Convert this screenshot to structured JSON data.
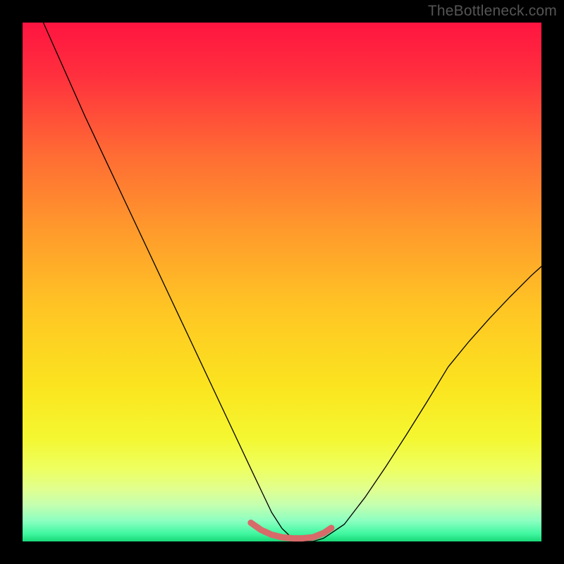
{
  "watermark": "TheBottleneck.com",
  "chart_data": {
    "type": "line",
    "title": "",
    "xlabel": "",
    "ylabel": "",
    "xlim": [
      0,
      100
    ],
    "ylim": [
      0,
      100
    ],
    "background_gradient": {
      "stops": [
        {
          "offset": 0.0,
          "color": "#ff1440"
        },
        {
          "offset": 0.1,
          "color": "#ff2f3e"
        },
        {
          "offset": 0.25,
          "color": "#ff6a34"
        },
        {
          "offset": 0.4,
          "color": "#ff9a2c"
        },
        {
          "offset": 0.55,
          "color": "#ffc524"
        },
        {
          "offset": 0.7,
          "color": "#fbe41f"
        },
        {
          "offset": 0.8,
          "color": "#f4f730"
        },
        {
          "offset": 0.86,
          "color": "#eeff60"
        },
        {
          "offset": 0.9,
          "color": "#e0ff90"
        },
        {
          "offset": 0.93,
          "color": "#c4ffb0"
        },
        {
          "offset": 0.96,
          "color": "#8cffc0"
        },
        {
          "offset": 0.985,
          "color": "#40f7a0"
        },
        {
          "offset": 1.0,
          "color": "#18d878"
        }
      ]
    },
    "series": [
      {
        "name": "bottleneck-curve",
        "color": "#000000",
        "stroke_width": 1.3,
        "x": [
          4,
          8,
          12,
          16,
          20,
          24,
          28,
          32,
          36,
          40,
          44,
          46,
          48,
          50,
          52,
          54,
          56,
          58,
          62,
          66,
          70,
          74,
          78,
          82,
          86,
          90,
          94,
          98,
          100
        ],
        "values": [
          100,
          91,
          82,
          73.5,
          65,
          56.5,
          48,
          39.5,
          31,
          22.5,
          14,
          9.8,
          5.6,
          2.5,
          0.6,
          0,
          0,
          0.6,
          3.3,
          8.5,
          14.4,
          20.6,
          27.0,
          33.6,
          38.5,
          43.0,
          47.2,
          51.2,
          53.0
        ]
      },
      {
        "name": "optimal-zone",
        "color": "#d86a6a",
        "stroke_width": 9,
        "linecap": "round",
        "x": [
          44,
          46,
          48,
          50,
          52,
          54,
          56,
          58,
          59.5
        ],
        "values": [
          3.6,
          2.2,
          1.3,
          0.8,
          0.6,
          0.6,
          0.8,
          1.6,
          2.6
        ]
      }
    ]
  }
}
